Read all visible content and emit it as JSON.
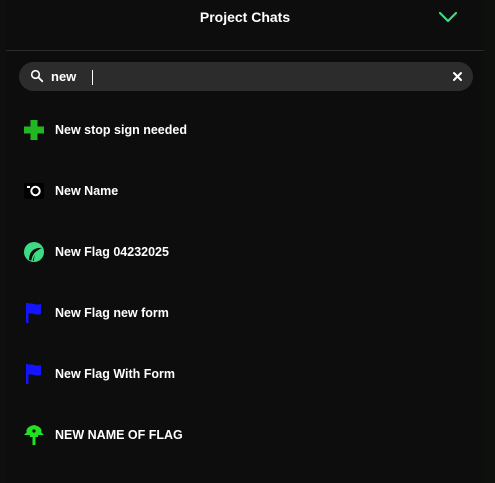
{
  "header": {
    "title": "Project Chats",
    "chevron_icon": "chevron-down-icon",
    "accent": "#3ddc84"
  },
  "search": {
    "value": "new",
    "search_icon": "search-icon",
    "clear_icon": "close-icon"
  },
  "chats": [
    {
      "label": "New stop sign needed",
      "icon": "green-plus-icon",
      "color": "#22b822"
    },
    {
      "label": "New Name",
      "icon": "camera-icon",
      "color": "#ffffff"
    },
    {
      "label": "New Flag 04232025",
      "icon": "green-emblem-icon",
      "color": "#3ddc84"
    },
    {
      "label": "New Flag new form",
      "icon": "blue-flag-icon",
      "color": "#1414ff"
    },
    {
      "label": "New Flag With Form",
      "icon": "blue-flag-icon",
      "color": "#1414ff"
    },
    {
      "label": "NEW NAME OF FLAG",
      "icon": "green-tree-icon",
      "color": "#22e022"
    }
  ]
}
